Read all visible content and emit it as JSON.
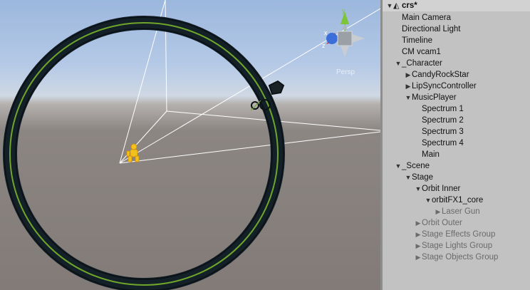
{
  "viewport": {
    "projection_label": "Persp",
    "gizmo_axes": [
      "y",
      "x",
      "z"
    ]
  },
  "hierarchy": {
    "scene_name": "crs*",
    "scene_icon": "unity-icon",
    "items": [
      {
        "label": "Main Camera",
        "depth": 1,
        "arrow": "none",
        "active": true
      },
      {
        "label": "Directional Light",
        "depth": 1,
        "arrow": "none",
        "active": true
      },
      {
        "label": "Timeline",
        "depth": 1,
        "arrow": "none",
        "active": true
      },
      {
        "label": "CM vcam1",
        "depth": 1,
        "arrow": "none",
        "active": true
      },
      {
        "label": "_Character",
        "depth": 1,
        "arrow": "down",
        "active": true
      },
      {
        "label": "CandyRockStar",
        "depth": 2,
        "arrow": "right",
        "active": true
      },
      {
        "label": "LipSyncController",
        "depth": 2,
        "arrow": "right",
        "active": true
      },
      {
        "label": "MusicPlayer",
        "depth": 2,
        "arrow": "down",
        "active": true
      },
      {
        "label": "Spectrum 1",
        "depth": 3,
        "arrow": "none",
        "active": true
      },
      {
        "label": "Spectrum 2",
        "depth": 3,
        "arrow": "none",
        "active": true
      },
      {
        "label": "Spectrum 3",
        "depth": 3,
        "arrow": "none",
        "active": true
      },
      {
        "label": "Spectrum 4",
        "depth": 3,
        "arrow": "none",
        "active": true
      },
      {
        "label": "Main",
        "depth": 3,
        "arrow": "none",
        "active": true
      },
      {
        "label": "_Scene",
        "depth": 1,
        "arrow": "down",
        "active": true
      },
      {
        "label": "Stage",
        "depth": 2,
        "arrow": "down",
        "active": true
      },
      {
        "label": "Orbit Inner",
        "depth": 3,
        "arrow": "down",
        "active": true
      },
      {
        "label": "orbitFX1_core",
        "depth": 4,
        "arrow": "down",
        "active": true
      },
      {
        "label": "Laser Gun",
        "depth": 5,
        "arrow": "right",
        "active": false
      },
      {
        "label": "Orbit Outer",
        "depth": 3,
        "arrow": "right",
        "active": false
      },
      {
        "label": "Stage Effects Group",
        "depth": 3,
        "arrow": "right",
        "active": false
      },
      {
        "label": "Stage Lights Group",
        "depth": 3,
        "arrow": "right",
        "active": false
      },
      {
        "label": "Stage Objects Group",
        "depth": 3,
        "arrow": "right",
        "active": false
      }
    ]
  },
  "colors": {
    "ring": "#142028",
    "ring_line": "#6fa62a",
    "character": "#f2c21c",
    "gizmo_x": "#d9352b",
    "gizmo_y": "#7ec43b",
    "gizmo_z": "#3b6ed9"
  }
}
